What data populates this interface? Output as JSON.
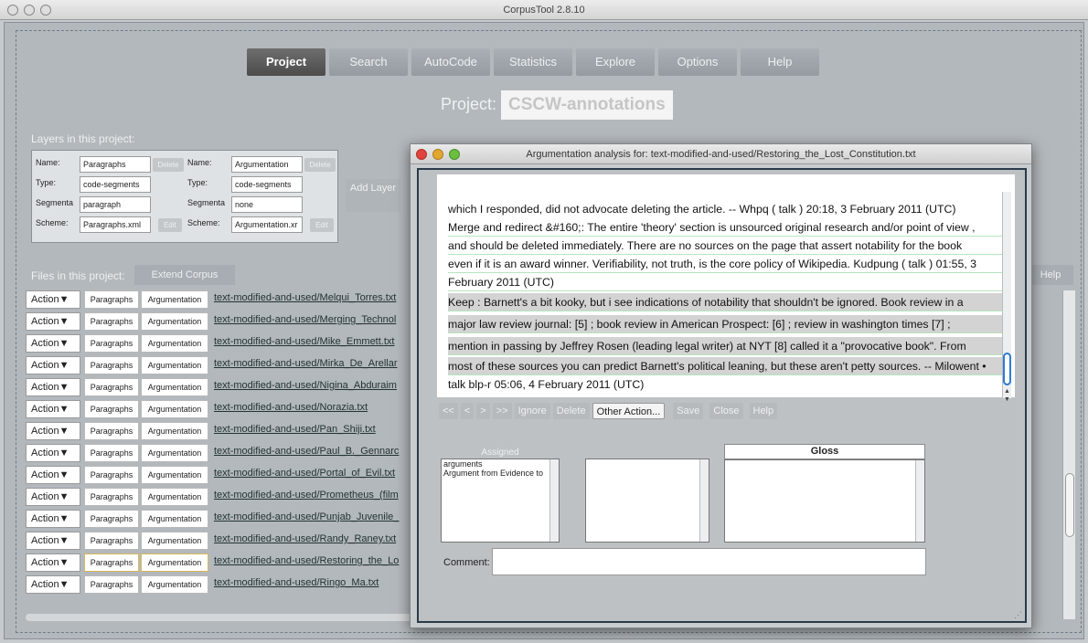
{
  "window": {
    "title": "CorpusTool 2.8.10"
  },
  "tabs": [
    {
      "label": "Project",
      "active": true
    },
    {
      "label": "Search"
    },
    {
      "label": "AutoCode"
    },
    {
      "label": "Statistics"
    },
    {
      "label": "Explore"
    },
    {
      "label": "Options"
    },
    {
      "label": "Help"
    }
  ],
  "project": {
    "label": "Project:",
    "name": "CSCW-annotations"
  },
  "layers": {
    "section_label": "Layers in this project:",
    "add_layer_label": "Add Layer",
    "field_labels": {
      "name": "Name:",
      "type": "Type:",
      "segment": "Segmenta",
      "scheme": "Scheme:"
    },
    "delete_label": "Delete",
    "edit_label": "Edit",
    "items": [
      {
        "name": "Paragraphs",
        "type": "code-segments",
        "segment": "paragraph",
        "scheme": "Paragraphs.xml"
      },
      {
        "name": "Argumentation",
        "type": "code-segments",
        "segment": "none",
        "scheme": "Argumentation.xr"
      }
    ]
  },
  "files": {
    "section_label": "Files in this project:",
    "extend_label": "Extend Corpus",
    "help_label": "Help",
    "action_label": "Action▼",
    "para_label": "Paragraphs",
    "arg_label": "Argumentation",
    "rows": [
      "text-modified-and-used/Melqui_Torres.txt",
      "text-modified-and-used/Merging_Technol",
      "text-modified-and-used/Mike_Emmett.txt",
      "text-modified-and-used/Mirka_De_Arellar",
      "text-modified-and-used/Nigina_Abduraim",
      "text-modified-and-used/Norazia.txt",
      "text-modified-and-used/Pan_Shiji.txt",
      "text-modified-and-used/Paul_B._Gennarc",
      "text-modified-and-used/Portal_of_Evil.txt",
      "text-modified-and-used/Prometheus_(film",
      "text-modified-and-used/Punjab_Juvenile_",
      "text-modified-and-used/Randy_Raney.txt",
      "text-modified-and-used/Restoring_the_Lo",
      "text-modified-and-used/Ringo_Ma.txt"
    ]
  },
  "dialog": {
    "title": "Argumentation analysis for: text-modified-and-used/Restoring_the_Lost_Constitution.txt",
    "lines": [
      "which I responded, did not advocate deleting the article. -- Whpq ( talk ) 20:18, 3 February 2011 (UTC)",
      "Merge and redirect &#160;: The entire 'theory' section is unsourced original research and/or point of view ,",
      "and should be deleted immediately. There are no sources on the page that assert notability for the book",
      "even if it is an award winner. Verifiability, not truth, is the core policy of Wikipedia. Kudpung ( talk ) 01:55, 3",
      "February 2011 (UTC)",
      "Keep : Barnett's a bit kooky, but i see indications of notability that shouldn't be ignored. Book review in a",
      "major law review journal: [5] ; book review in American Prospect: [6] ; review in washington times [7] ;",
      "mention in passing by Jeffrey Rosen (leading legal writer) at NYT [8] called it a \"provocative book\". From",
      "most of these sources you can predict Barnett's political leaning, but these aren't petty sources. -- Milowent •",
      "talk blp-r 05:06, 4 February 2011 (UTC)"
    ],
    "nav": {
      "first": "<<",
      "prev": "<",
      "next": ">",
      "last": ">>",
      "ignore": "Ignore",
      "delete": "Delete",
      "other": "Other Action...",
      "save": "Save",
      "close": "Close",
      "help": "Help"
    },
    "assigned_label": "Assigned",
    "assigned_items": [
      "arguments",
      "Argument from Evidence to"
    ],
    "gloss_label": "Gloss",
    "comment_label": "Comment:"
  }
}
